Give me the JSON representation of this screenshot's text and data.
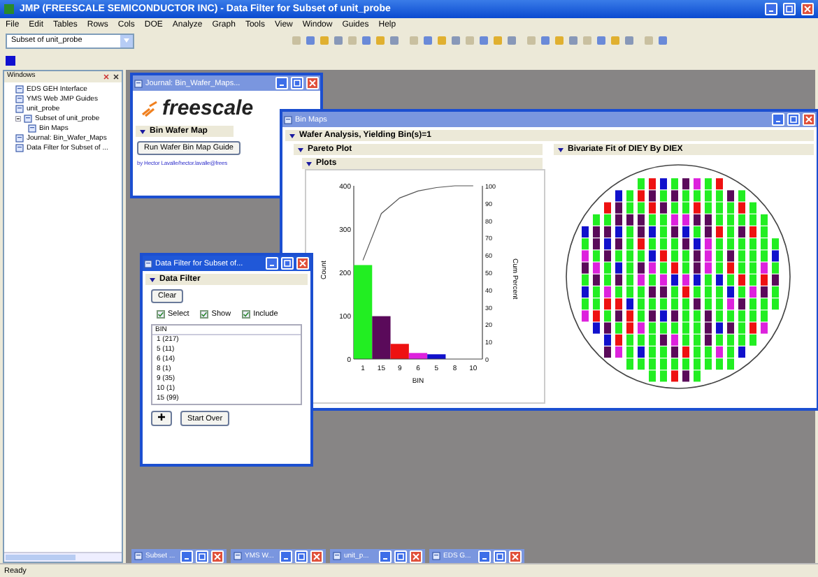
{
  "window": {
    "title": "JMP (FREESCALE SEMICONDUCTOR INC) - Data Filter for Subset of unit_probe"
  },
  "menu": [
    "File",
    "Edit",
    "Tables",
    "Rows",
    "Cols",
    "DOE",
    "Analyze",
    "Graph",
    "Tools",
    "View",
    "Window",
    "Guides",
    "Help"
  ],
  "toolbar": {
    "table_combo": "Subset of unit_probe"
  },
  "windows_panel": {
    "title": "Windows",
    "items": [
      {
        "label": "EDS GEH Interface",
        "expanded": false
      },
      {
        "label": "YMS Web JMP Guides",
        "expanded": false
      },
      {
        "label": "unit_probe",
        "expanded": false
      },
      {
        "label": "Subset of unit_probe",
        "expanded": true,
        "children": [
          {
            "label": "Bin Maps",
            "expanded": false
          }
        ]
      },
      {
        "label": "Journal: Bin_Wafer_Maps",
        "expanded": false
      },
      {
        "label": "Data Filter for Subset of ...",
        "expanded": false
      }
    ]
  },
  "journal": {
    "title": "Journal: Bin_Wafer_Maps...",
    "logo": "freescale",
    "heading": "Bin Wafer Map",
    "button": "Run Wafer Bin Map Guide",
    "author_link": "by Hector Lavalle/hector.lavalle@frees"
  },
  "bin_maps": {
    "title": "Bin Maps",
    "outline": "Wafer Analysis, Yielding Bin(s)=1",
    "pareto_title": "Pareto Plot",
    "plots_title": "Plots",
    "bivariate_title": "Bivariate Fit of DIEY By DIEX",
    "chart_data": {
      "type": "bar",
      "xlabel": "BIN",
      "ylabel": "Count",
      "categories": [
        "1",
        "15",
        "9",
        "6",
        "5",
        "8",
        "10"
      ],
      "series": [
        {
          "color": "#22ee22",
          "values": [
            217,
            null,
            null,
            null,
            null,
            null,
            null
          ]
        },
        {
          "color": "#5a0a5a",
          "values": [
            null,
            99,
            null,
            null,
            null,
            null,
            null
          ]
        },
        {
          "color": "#ee1111",
          "values": [
            null,
            null,
            35,
            null,
            null,
            null,
            null
          ]
        },
        {
          "color": "#dd22dd",
          "values": [
            null,
            null,
            null,
            14,
            null,
            null,
            null
          ]
        },
        {
          "color": "#1111cc",
          "values": [
            null,
            null,
            null,
            null,
            11,
            null,
            null
          ]
        },
        {
          "name": "Cum Percent",
          "type": "line",
          "axis": "y2",
          "color": "#555555",
          "values": [
            57,
            84,
            93,
            97,
            99,
            100,
            100
          ]
        }
      ],
      "ylim": [
        0,
        400
      ],
      "yticks": [
        0,
        100,
        200,
        300,
        400
      ],
      "y2lim": [
        0,
        100
      ],
      "y2ticks": [
        0,
        10,
        20,
        30,
        40,
        50,
        60,
        70,
        80,
        90,
        100
      ]
    }
  },
  "data_filter": {
    "title": "Data Filter for Subset of...",
    "heading": "Data Filter",
    "clear_button": "Clear",
    "options": [
      {
        "label": "Select",
        "checked": true
      },
      {
        "label": "Show",
        "checked": true
      },
      {
        "label": "Include",
        "checked": true
      }
    ],
    "list_title": "BIN",
    "values": [
      {
        "label": "1 (217)",
        "selected": false
      },
      {
        "label": "5 (11)",
        "selected": false
      },
      {
        "label": "6 (14)",
        "selected": false
      },
      {
        "label": "8 (1)",
        "selected": false
      },
      {
        "label": "9 (35)",
        "selected": false
      },
      {
        "label": "10 (1)",
        "selected": false
      },
      {
        "label": "15 (99)",
        "selected": false
      }
    ],
    "start_over_button": "Start Over"
  },
  "minimized": [
    {
      "title": "Subset ..."
    },
    {
      "title": "YMS W..."
    },
    {
      "title": "unit_p..."
    },
    {
      "title": "EDS G..."
    }
  ],
  "status_bar": "Ready"
}
